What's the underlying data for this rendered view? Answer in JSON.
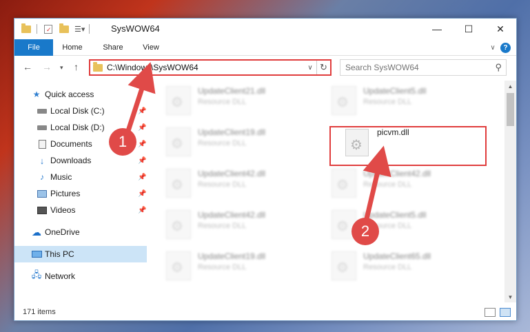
{
  "window": {
    "title": "SysWOW64"
  },
  "ribbon": {
    "file": "File",
    "home": "Home",
    "share": "Share",
    "view": "View",
    "help": "?"
  },
  "titlebar": {
    "minimize": "—",
    "maximize": "☐",
    "close": "✕"
  },
  "address": {
    "path": "C:\\Windows\\SysWOW64"
  },
  "search": {
    "placeholder": "Search SysWOW64"
  },
  "sidebar": {
    "items": [
      {
        "label": "Quick access",
        "icon": "star-icon"
      },
      {
        "label": "Local Disk (C:)",
        "icon": "drive-icon",
        "pinned": true
      },
      {
        "label": "Local Disk (D:)",
        "icon": "drive-icon",
        "pinned": true
      },
      {
        "label": "Documents",
        "icon": "documents-icon",
        "pinned": true
      },
      {
        "label": "Downloads",
        "icon": "download-icon",
        "pinned": true
      },
      {
        "label": "Music",
        "icon": "music-icon",
        "pinned": true
      },
      {
        "label": "Pictures",
        "icon": "pictures-icon",
        "pinned": true
      },
      {
        "label": "Videos",
        "icon": "videos-icon",
        "pinned": true
      },
      {
        "label": "OneDrive",
        "icon": "cloud-icon"
      },
      {
        "label": "This PC",
        "icon": "computer-icon",
        "selected": true
      },
      {
        "label": "Network",
        "icon": "network-icon"
      }
    ]
  },
  "files": [
    {
      "name": "UpdateClient21.dll",
      "type": "Resource DLL"
    },
    {
      "name": "UpdateClient5.dll",
      "type": "Resource DLL"
    },
    {
      "name": "UpdateClient19.dll",
      "type": "Resource DLL"
    },
    {
      "name": "picvm.dll",
      "type": ""
    },
    {
      "name": "UpdateClient42.dll",
      "type": "Resource DLL"
    },
    {
      "name": "UpdateClient42.dll",
      "type": "Resource DLL"
    },
    {
      "name": "UpdateClient42.dll",
      "type": "Resource DLL"
    },
    {
      "name": "UpdateClient5.dll",
      "type": "Resource DLL"
    },
    {
      "name": "UpdateClient19.dll",
      "type": "Resource DLL"
    },
    {
      "name": "UpdateClient65.dll",
      "type": "Resource DLL"
    }
  ],
  "status": {
    "count": "171 items"
  },
  "markers": {
    "one": "1",
    "two": "2"
  },
  "colors": {
    "accent": "#1979ca",
    "highlight": "#e03c3c",
    "marker": "#e04a48"
  }
}
